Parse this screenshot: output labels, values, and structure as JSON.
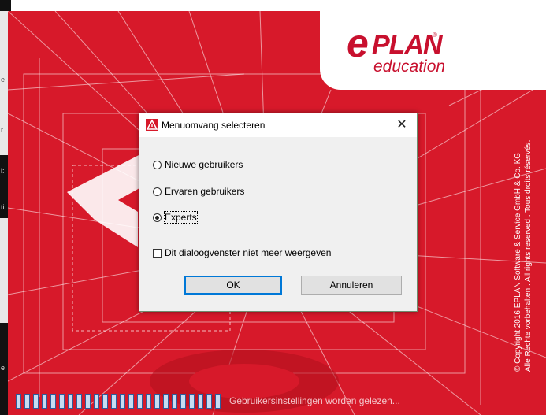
{
  "desktop": {
    "fragments": [
      "e",
      "r",
      "i:",
      "ti",
      "e"
    ]
  },
  "splash": {
    "logo": {
      "e": "e",
      "plan": "PLAN",
      "registered": "®",
      "education": "education"
    },
    "copyright_line1": "© Copyright 2016 EPLAN Software & Service GmbH & Co. KG",
    "copyright_line2": "Alle Rechte vorbehalten . All rights reserved . Tous droits réservés.",
    "progress": {
      "segments_filled": 24,
      "color": "#c6dcf2"
    },
    "status_text": "Gebruikersinstellingen worden gelezen...",
    "background_color": "#d7192a"
  },
  "dialog": {
    "title": "Menuomvang selecteren",
    "close_label": "✕",
    "options": [
      {
        "label": "Nieuwe gebruikers",
        "checked": false
      },
      {
        "label": "Ervaren gebruikers",
        "checked": false
      },
      {
        "label": "Experts",
        "checked": true
      }
    ],
    "checkbox_label": "Dit dialoogvenster niet meer weergeven",
    "checkbox_checked": false,
    "ok_label": "OK",
    "cancel_label": "Annuleren",
    "accent_color": "#0078d7"
  }
}
